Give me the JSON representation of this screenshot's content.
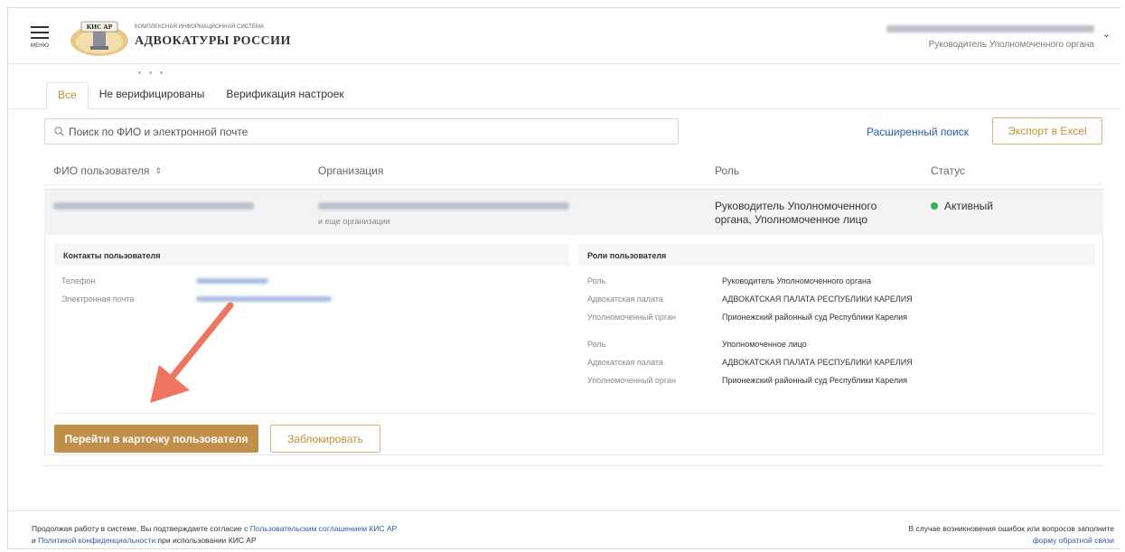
{
  "header": {
    "menu_caption": "МЕНЮ",
    "logo_badge": "КИС АР",
    "logo_subtitle": "КОМПЛЕКСНАЯ ИНФОРМАЦИОННАЯ СИСТЕМА",
    "logo_title": "АДВОКАТУРЫ РОССИИ",
    "user_role": "Руководитель Уполномоченного органа"
  },
  "tabs": [
    {
      "label": "Все",
      "active": true
    },
    {
      "label": "Не верифицированы",
      "active": false
    },
    {
      "label": "Верификация настроек",
      "active": false
    }
  ],
  "search": {
    "placeholder": "Поиск по ФИО и электронной почте",
    "value": ""
  },
  "toolbar": {
    "advanced_search": "Расширенный поиск",
    "export": "Экспорт в Excel"
  },
  "table": {
    "columns": [
      "ФИО пользователя",
      "Организация",
      "Роль",
      "Статус"
    ],
    "row": {
      "org_more": "и еще организации",
      "role": "Руководитель Уполномоченного органа, Уполномоченное лицо",
      "status": "Активный",
      "status_color": "#3ab54a"
    }
  },
  "details": {
    "contacts_title": "Контакты пользователя",
    "phone_label": "Телефон",
    "email_label": "Электронная почта",
    "roles_title": "Роли пользователя",
    "roles": [
      {
        "role_label": "Роль",
        "role": "Руководитель Уполномоченного органа",
        "chamber_label": "Адвокатская палата",
        "chamber": "АДВОКАТСКАЯ ПАЛАТА РЕСПУБЛИКИ КАРЕЛИЯ",
        "body_label": "Уполномоченный орган",
        "body": "Прионежский районный суд Республики Карелия"
      },
      {
        "role_label": "Роль",
        "role": "Уполномоченное лицо",
        "chamber_label": "Адвокатская палата",
        "chamber": "АДВОКАТСКАЯ ПАЛАТА РЕСПУБЛИКИ КАРЕЛИЯ",
        "body_label": "Уполномоченный орган",
        "body": "Прионежский районный суд Республики Карелия"
      }
    ],
    "open_card_button": "Перейти в карточку пользователя",
    "block_button": "Заблокировать"
  },
  "footer": {
    "left_prefix": "Продолжая работу в системе, Вы подтверждаете согласие с ",
    "left_link1": "Пользовательским соглашением КИС АР",
    "left_line2_prefix": "и ",
    "left_link2": "Политикой конфиденциальности",
    "left_line2_suffix": " при использовании КИС АР",
    "right_text": "В случае возникновения ошибок или вопросов заполните",
    "right_link": "форму обратной связи"
  },
  "colors": {
    "accent": "#c58f33",
    "primary_button": "#c0904a",
    "link": "#2e5aa8",
    "annotation_arrow": "#f07560"
  }
}
